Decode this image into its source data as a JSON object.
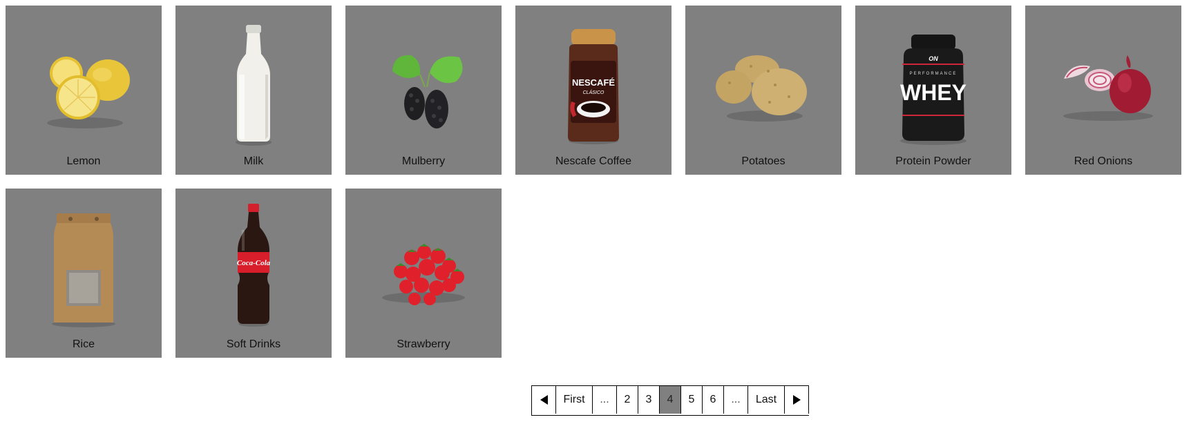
{
  "products": [
    {
      "name": "Lemon",
      "icon": "lemon-icon"
    },
    {
      "name": "Milk",
      "icon": "milk-bottle-icon"
    },
    {
      "name": "Mulberry",
      "icon": "mulberry-icon"
    },
    {
      "name": "Nescafe Coffee",
      "icon": "coffee-jar-icon"
    },
    {
      "name": "Potatoes",
      "icon": "potatoes-icon"
    },
    {
      "name": "Protein Powder",
      "icon": "protein-tub-icon"
    },
    {
      "name": "Red Onions",
      "icon": "red-onions-icon"
    },
    {
      "name": "Rice",
      "icon": "rice-bag-icon"
    },
    {
      "name": "Soft Drinks",
      "icon": "cola-bottle-icon"
    },
    {
      "name": "Strawberry",
      "icon": "strawberries-icon"
    }
  ],
  "product_images": {
    "nescafe_brand": "NESCAFÉ",
    "nescafe_sub": "CLÁSICO",
    "protein_brand": "ON",
    "protein_line": "PERFORMANCE",
    "protein_name": "WHEY",
    "cola_brand": "Coca-Cola"
  },
  "pagination": {
    "prev_icon": "triangle-left-icon",
    "first": "First",
    "ellipsis_left": "...",
    "pages": [
      "2",
      "3",
      "4",
      "5",
      "6"
    ],
    "current": "4",
    "ellipsis_right": "...",
    "last": "Last",
    "next_icon": "triangle-right-icon"
  },
  "colors": {
    "tile_background": "#808080",
    "active_page": "#808080",
    "page_background": "#ffffff"
  }
}
